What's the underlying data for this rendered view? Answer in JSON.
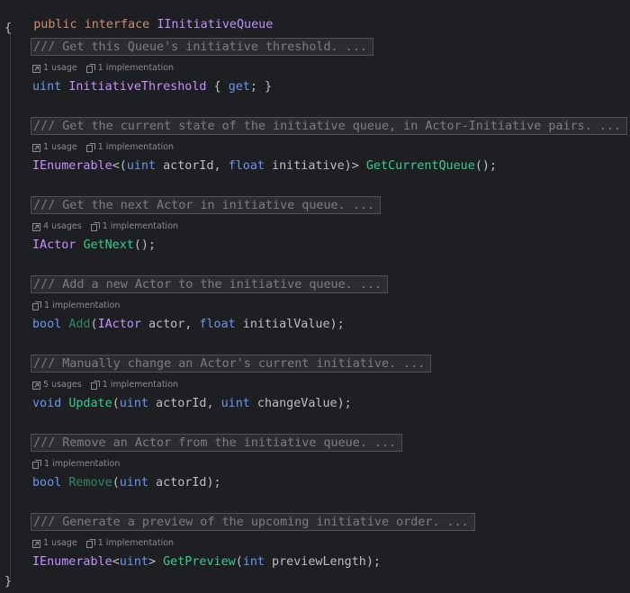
{
  "code": {
    "decl": {
      "kw_public": "public",
      "kw_interface": "interface",
      "name": "IInitiativeQueue"
    },
    "open_brace": "{",
    "close_brace": "}",
    "members": [
      {
        "doc": "/// Get this Queue's initiative threshold. ...",
        "hints": [
          {
            "icon": "usages-icon",
            "text": "1 usage"
          },
          {
            "icon": "implementation-icon",
            "text": "1 implementation"
          }
        ],
        "tokens": [
          {
            "t": "uint",
            "c": "kw2"
          },
          {
            "t": " ",
            "c": "plain"
          },
          {
            "t": "InitiativeThreshold",
            "c": "type"
          },
          {
            "t": " { ",
            "c": "plain"
          },
          {
            "t": "get",
            "c": "kw2"
          },
          {
            "t": "; }",
            "c": "plain"
          }
        ]
      },
      {
        "doc": "/// Get the current state of the initiative queue, in Actor-Initiative pairs. ...",
        "hints": [
          {
            "icon": "usages-icon",
            "text": "1 usage"
          },
          {
            "icon": "implementation-icon",
            "text": "1 implementation"
          }
        ],
        "tokens": [
          {
            "t": "IEnumerable",
            "c": "type"
          },
          {
            "t": "<(",
            "c": "plain"
          },
          {
            "t": "uint",
            "c": "kw2"
          },
          {
            "t": " actorId, ",
            "c": "param"
          },
          {
            "t": "float",
            "c": "kw2"
          },
          {
            "t": " initiative)> ",
            "c": "param"
          },
          {
            "t": "GetCurrentQueue",
            "c": "meth"
          },
          {
            "t": "();",
            "c": "plain"
          }
        ]
      },
      {
        "doc": "/// Get the next Actor in initiative queue. ...",
        "hints": [
          {
            "icon": "usages-icon",
            "text": "4 usages"
          },
          {
            "icon": "implementation-icon",
            "text": "1 implementation"
          }
        ],
        "tokens": [
          {
            "t": "IActor",
            "c": "type"
          },
          {
            "t": " ",
            "c": "plain"
          },
          {
            "t": "GetNext",
            "c": "meth"
          },
          {
            "t": "();",
            "c": "plain"
          }
        ]
      },
      {
        "doc": "/// Add a new Actor to the initiative queue. ...",
        "hints": [
          {
            "icon": "implementation-icon",
            "text": "1 implementation"
          }
        ],
        "tokens": [
          {
            "t": "bool",
            "c": "kw2"
          },
          {
            "t": " ",
            "c": "plain"
          },
          {
            "t": "Add",
            "c": "meth-unused"
          },
          {
            "t": "(",
            "c": "plain"
          },
          {
            "t": "IActor",
            "c": "type"
          },
          {
            "t": " actor, ",
            "c": "param"
          },
          {
            "t": "float",
            "c": "kw2"
          },
          {
            "t": " initialValue);",
            "c": "param"
          }
        ]
      },
      {
        "doc": "/// Manually change an Actor's current initiative. ...",
        "hints": [
          {
            "icon": "usages-icon",
            "text": "5 usages"
          },
          {
            "icon": "implementation-icon",
            "text": "1 implementation"
          }
        ],
        "tokens": [
          {
            "t": "void",
            "c": "kw2"
          },
          {
            "t": " ",
            "c": "plain"
          },
          {
            "t": "Update",
            "c": "meth"
          },
          {
            "t": "(",
            "c": "plain"
          },
          {
            "t": "uint",
            "c": "kw2"
          },
          {
            "t": " actorId, ",
            "c": "param"
          },
          {
            "t": "uint",
            "c": "kw2"
          },
          {
            "t": " changeValue);",
            "c": "param"
          }
        ]
      },
      {
        "doc": "/// Remove an Actor from the initiative queue. ...",
        "hints": [
          {
            "icon": "implementation-icon",
            "text": "1 implementation"
          }
        ],
        "tokens": [
          {
            "t": "bool",
            "c": "kw2"
          },
          {
            "t": " ",
            "c": "plain"
          },
          {
            "t": "Remove",
            "c": "meth-unused"
          },
          {
            "t": "(",
            "c": "plain"
          },
          {
            "t": "uint",
            "c": "kw2"
          },
          {
            "t": " actorId);",
            "c": "param"
          }
        ]
      },
      {
        "doc": "/// Generate a preview of the upcoming initiative order. ...",
        "hints": [
          {
            "icon": "usages-icon",
            "text": "1 usage"
          },
          {
            "icon": "implementation-icon",
            "text": "1 implementation"
          }
        ],
        "tokens": [
          {
            "t": "IEnumerable",
            "c": "type"
          },
          {
            "t": "<",
            "c": "plain"
          },
          {
            "t": "uint",
            "c": "kw2"
          },
          {
            "t": "> ",
            "c": "plain"
          },
          {
            "t": "GetPreview",
            "c": "meth"
          },
          {
            "t": "(",
            "c": "plain"
          },
          {
            "t": "int",
            "c": "kw2"
          },
          {
            "t": " previewLength);",
            "c": "param"
          }
        ]
      }
    ]
  },
  "colors": {
    "background": "#1e1f22",
    "keyword": "#cf8e6d",
    "builtin_type": "#6c95eb",
    "type_name": "#c191ff",
    "method": "#39cc8f",
    "doc_comment": "#7a7e85"
  }
}
